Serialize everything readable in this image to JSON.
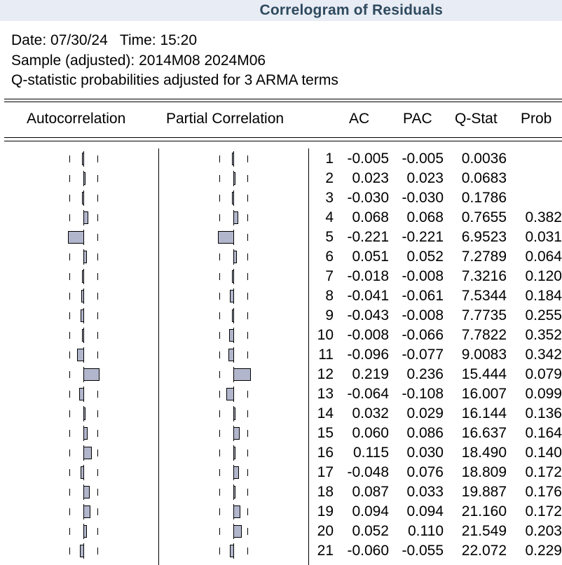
{
  "window": {
    "title": "Correlogram of Residuals"
  },
  "meta": {
    "date_line": "Date: 07/30/24   Time: 15:20",
    "sample_line": "Sample (adjusted): 2014M08 2024M06",
    "note_line": "Q-statistic probabilities adjusted for 3 ARMA terms"
  },
  "headers": {
    "autocorrelation": "Autocorrelation",
    "partial_correlation": "Partial Correlation",
    "ac": "AC",
    "pac": "PAC",
    "qstat": "Q-Stat",
    "prob": "Prob"
  },
  "rows": [
    {
      "lag": "1",
      "ac": "-0.005",
      "pac": "-0.005",
      "q": "0.0036",
      "prob": ""
    },
    {
      "lag": "2",
      "ac": "0.023",
      "pac": "0.023",
      "q": "0.0683",
      "prob": ""
    },
    {
      "lag": "3",
      "ac": "-0.030",
      "pac": "-0.030",
      "q": "0.1786",
      "prob": ""
    },
    {
      "lag": "4",
      "ac": "0.068",
      "pac": "0.068",
      "q": "0.7655",
      "prob": "0.382"
    },
    {
      "lag": "5",
      "ac": "-0.221",
      "pac": "-0.221",
      "q": "6.9523",
      "prob": "0.031"
    },
    {
      "lag": "6",
      "ac": "0.051",
      "pac": "0.052",
      "q": "7.2789",
      "prob": "0.064"
    },
    {
      "lag": "7",
      "ac": "-0.018",
      "pac": "-0.008",
      "q": "7.3216",
      "prob": "0.120"
    },
    {
      "lag": "8",
      "ac": "-0.041",
      "pac": "-0.061",
      "q": "7.5344",
      "prob": "0.184"
    },
    {
      "lag": "9",
      "ac": "-0.043",
      "pac": "-0.008",
      "q": "7.7735",
      "prob": "0.255"
    },
    {
      "lag": "10",
      "ac": "-0.008",
      "pac": "-0.066",
      "q": "7.7822",
      "prob": "0.352"
    },
    {
      "lag": "11",
      "ac": "-0.096",
      "pac": "-0.077",
      "q": "9.0083",
      "prob": "0.342"
    },
    {
      "lag": "12",
      "ac": "0.219",
      "pac": "0.236",
      "q": "15.444",
      "prob": "0.079"
    },
    {
      "lag": "13",
      "ac": "-0.064",
      "pac": "-0.108",
      "q": "16.007",
      "prob": "0.099"
    },
    {
      "lag": "14",
      "ac": "0.032",
      "pac": "0.029",
      "q": "16.144",
      "prob": "0.136"
    },
    {
      "lag": "15",
      "ac": "0.060",
      "pac": "0.086",
      "q": "16.637",
      "prob": "0.164"
    },
    {
      "lag": "16",
      "ac": "0.115",
      "pac": "0.030",
      "q": "18.490",
      "prob": "0.140"
    },
    {
      "lag": "17",
      "ac": "-0.048",
      "pac": "0.076",
      "q": "18.809",
      "prob": "0.172"
    },
    {
      "lag": "18",
      "ac": "0.087",
      "pac": "0.033",
      "q": "19.887",
      "prob": "0.176"
    },
    {
      "lag": "19",
      "ac": "0.094",
      "pac": "0.094",
      "q": "21.160",
      "prob": "0.172"
    },
    {
      "lag": "20",
      "ac": "0.052",
      "pac": "0.110",
      "q": "21.549",
      "prob": "0.203"
    },
    {
      "lag": "21",
      "ac": "-0.060",
      "pac": "-0.055",
      "q": "22.072",
      "prob": "0.229"
    }
  ],
  "colors": {
    "bar_fill": "#b2b6cc",
    "title_text": "#2e4a5e",
    "title_bg": "#e8ecf4"
  }
}
